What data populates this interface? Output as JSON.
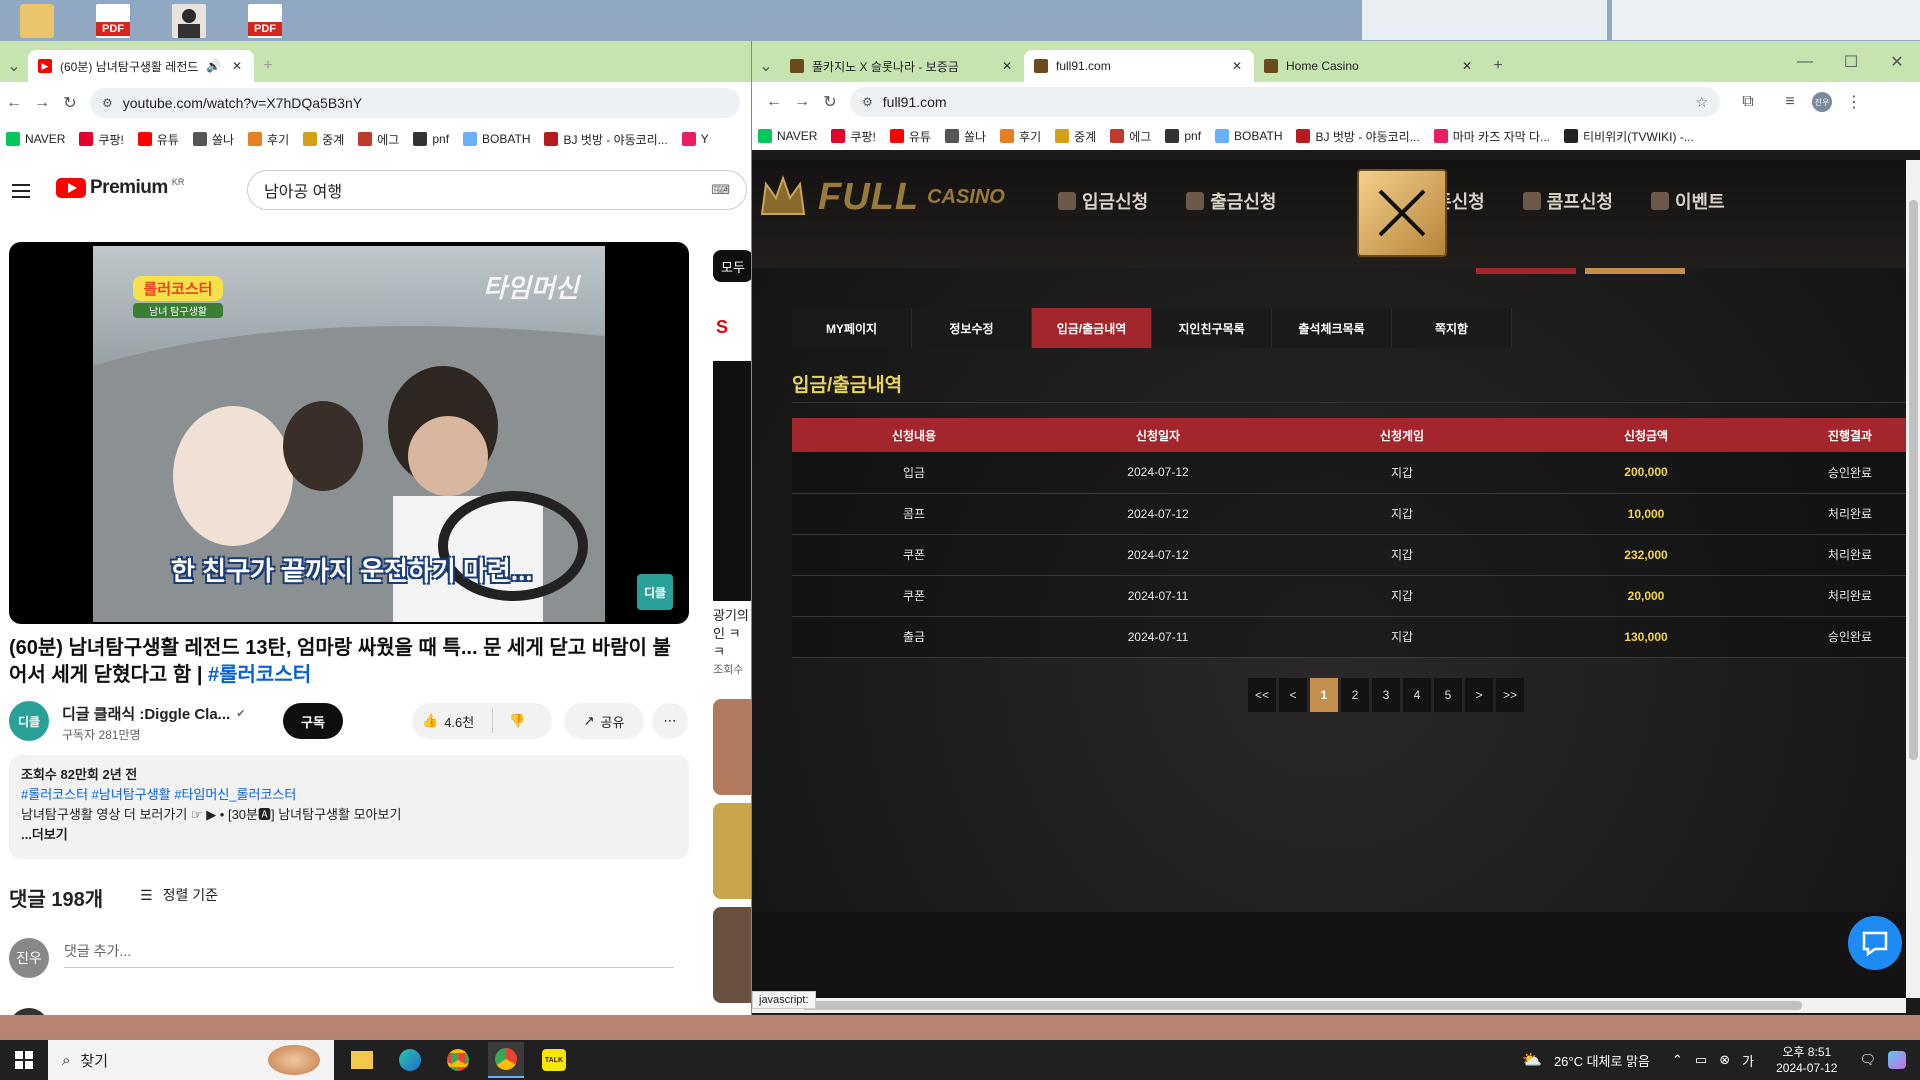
{
  "desktop": {
    "pdf_label": "PDF"
  },
  "yt_window": {
    "tab_title": "(60분) 남녀탐구생활 레전드",
    "url": "youtube.com/watch?v=X7hDQa5B3nY",
    "bookmarks": [
      "NAVER",
      "쿠팡!",
      "유튜",
      "쏠나",
      "후기",
      "중계",
      "에그",
      "pnf",
      "BOBATH",
      "BJ 벗방 - 야동코리...",
      "Y"
    ],
    "logo_text": "Premium",
    "logo_kr": "KR",
    "search_value": "남아공 여행",
    "video_title": "(60분) 남녀탐구생활 레전드 13탄, 엄마랑 싸웠을 때 특... 문 세게 닫고 바람이 불어서 세게 닫혔다고 함 |",
    "video_tag": "#롤러코스터",
    "video_subtitle": "한 친구가 끝까지 운전하기 마련...",
    "video_logo": "롤러코스터",
    "video_logo_sub": "남녀 탐구생활",
    "video_brand": "디클",
    "video_watermark": "타임머신",
    "channel_name": "디글 클래식 :Diggle Cla...",
    "channel_subs": "구독자 281만명",
    "channel_avatar": "디클",
    "subscribe_label": "구독",
    "like_count": "4.6천",
    "share_label": "공유",
    "desc_meta": "조회수 82만회  2년 전",
    "desc_tags": "#롤러코스터 #남녀탐구생활 #타임머신_롤러코스터",
    "desc_line": "남녀탐구생활 영상 더 보러가기 ☞ ▶ • [30분🅰] 남녀탐구생활 모아보기",
    "desc_more": "...더보기",
    "comments_count": "댓글 198개",
    "sort_label": "정렬 기준",
    "comment_placeholder": "댓글 추가...",
    "user_avatar": "진우",
    "side_chip": "모두",
    "side_text1": "광기의",
    "side_text2": "인 ㅋㅋ",
    "side_text3": "조회수"
  },
  "casino_window": {
    "tabs": [
      {
        "title": "풀카지노 X 슬롯나라 - 보증금",
        "active": false
      },
      {
        "title": "full91.com",
        "active": true
      },
      {
        "title": "Home Casino",
        "active": false
      }
    ],
    "url": "full91.com",
    "profile_initials": "진우",
    "bookmarks": [
      "NAVER",
      "쿠팡!",
      "유튜",
      "쏠나",
      "후기",
      "중계",
      "에그",
      "pnf",
      "BOBATH",
      "BJ 벗방 - 야동코리...",
      "마마 카즈 자막 다...",
      "티비위키(TVWIKI) -..."
    ],
    "status_text": "javascript:",
    "logo_main": "FULL",
    "logo_sub": "CASINO",
    "menu": [
      "입금신청",
      "출금신청",
      "쿠폰신청",
      "콤프신청",
      "이벤트"
    ],
    "subtabs": [
      "MY페이지",
      "정보수정",
      "입금/출금내역",
      "지인친구목록",
      "출석체크목록",
      "쪽지함"
    ],
    "active_subtab": 2,
    "section_title": "입금/출금내역",
    "columns": [
      "신청내용",
      "신청일자",
      "신청게임",
      "신청금액",
      "진행결과"
    ],
    "rows": [
      [
        "입금",
        "2024-07-12",
        "지갑",
        "200,000",
        "승인완료"
      ],
      [
        "콤프",
        "2024-07-12",
        "지갑",
        "10,000",
        "처리완료"
      ],
      [
        "쿠폰",
        "2024-07-12",
        "지갑",
        "232,000",
        "처리완료"
      ],
      [
        "쿠폰",
        "2024-07-11",
        "지갑",
        "20,000",
        "처리완료"
      ],
      [
        "출금",
        "2024-07-11",
        "지갑",
        "130,000",
        "승인완료"
      ]
    ],
    "pagination": [
      "<<",
      "<",
      "1",
      "2",
      "3",
      "4",
      "5",
      ">",
      ">>"
    ],
    "current_page": "1"
  },
  "taskbar": {
    "search_label": "찾기",
    "weather": "26°C  대체로 맑음",
    "time": "오후 8:51",
    "date": "2024-07-12",
    "talk_label": "TALK"
  },
  "colors": {
    "casino_red": "#a3262c",
    "casino_gold": "#c48f4c",
    "amount_yellow": "#f2d84a",
    "tab_green": "#c6e3b0"
  }
}
